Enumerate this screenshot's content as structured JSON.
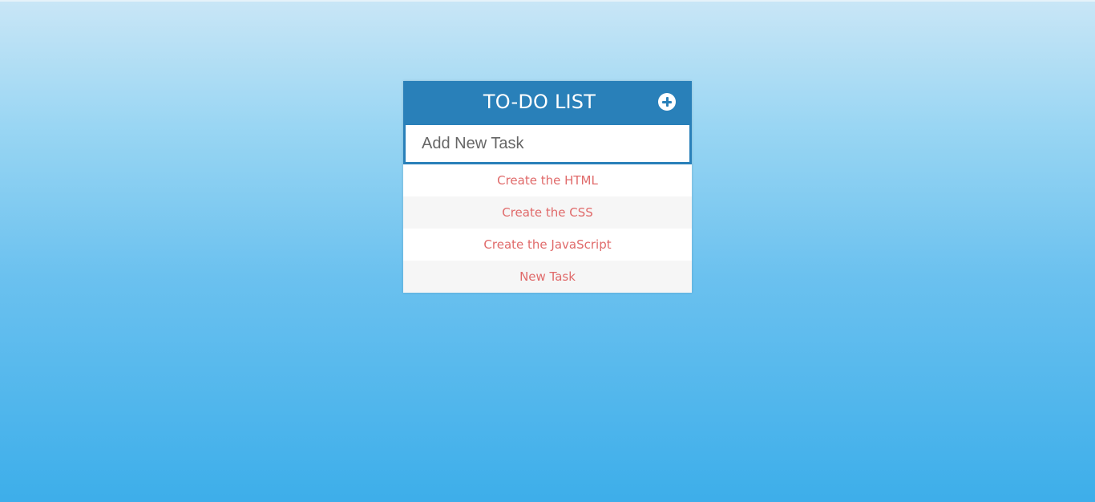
{
  "header": {
    "title": "TO-DO LIST",
    "add_icon": "plus-circle-icon"
  },
  "input": {
    "placeholder": "Add New Task",
    "value": ""
  },
  "tasks": [
    {
      "label": "Create the HTML"
    },
    {
      "label": "Create the CSS"
    },
    {
      "label": "Create the JavaScript"
    },
    {
      "label": "New Task"
    }
  ],
  "colors": {
    "header_bg": "#2980b9",
    "task_text": "#e06a6a",
    "background_top": "#c9e6f6",
    "background_bottom": "#3daeea"
  }
}
